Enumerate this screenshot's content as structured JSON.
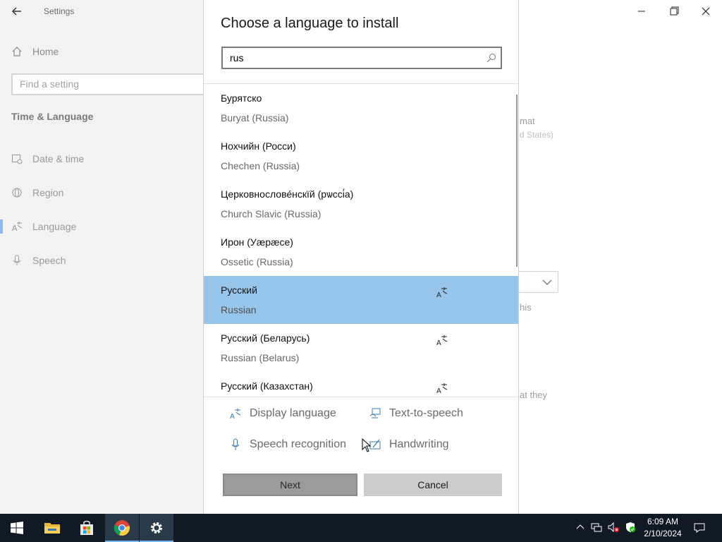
{
  "settings": {
    "app_title": "Settings",
    "nav": {
      "home_label": "Home",
      "search_placeholder": "Find a setting",
      "section_title": "Time & Language",
      "items": [
        {
          "label": "Date & time",
          "icon": "calendar-clock-icon"
        },
        {
          "label": "Region",
          "icon": "globe-icon"
        },
        {
          "label": "Language",
          "icon": "language-icon",
          "active": true
        },
        {
          "label": "Speech",
          "icon": "microphone-icon"
        }
      ]
    },
    "background_fragments": {
      "format": "mat",
      "states": "d States)",
      "this": "his",
      "they": "at they"
    }
  },
  "dialog": {
    "title": "Choose a language to install",
    "search": {
      "value": "rus",
      "icon": "search-icon"
    },
    "languages": [
      {
        "native": "Бурятско",
        "english": "Buryat (Russia)",
        "display_pack": false,
        "selected": false
      },
      {
        "native": "Нохчийн (Росси)",
        "english": "Chechen (Russia)",
        "display_pack": false,
        "selected": false
      },
      {
        "native": "Церковнослове́нскїй (рѡссі́а)",
        "english": "Church Slavic (Russia)",
        "display_pack": false,
        "selected": false
      },
      {
        "native": "Ирон (Уæрæсе)",
        "english": "Ossetic (Russia)",
        "display_pack": false,
        "selected": false
      },
      {
        "native": "Русский",
        "english": "Russian",
        "display_pack": true,
        "selected": true
      },
      {
        "native": "Русский (Беларусь)",
        "english": "Russian (Belarus)",
        "display_pack": true,
        "selected": false
      },
      {
        "native": "Русский (Казахстан)",
        "english": "",
        "display_pack": true,
        "selected": false
      }
    ],
    "features": {
      "display_language": "Display language",
      "text_to_speech": "Text-to-speech",
      "speech_recognition": "Speech recognition",
      "handwriting": "Handwriting"
    },
    "buttons": {
      "next": "Next",
      "cancel": "Cancel"
    }
  },
  "taskbar": {
    "apps": [
      "start-button",
      "file-explorer",
      "microsoft-store",
      "chrome",
      "settings"
    ],
    "clock": {
      "time": "6:09 AM",
      "date": "2/10/2024"
    }
  },
  "colors": {
    "selection": "#98c6eb",
    "accent": "#76b9ed",
    "taskbar": "#101a24"
  }
}
